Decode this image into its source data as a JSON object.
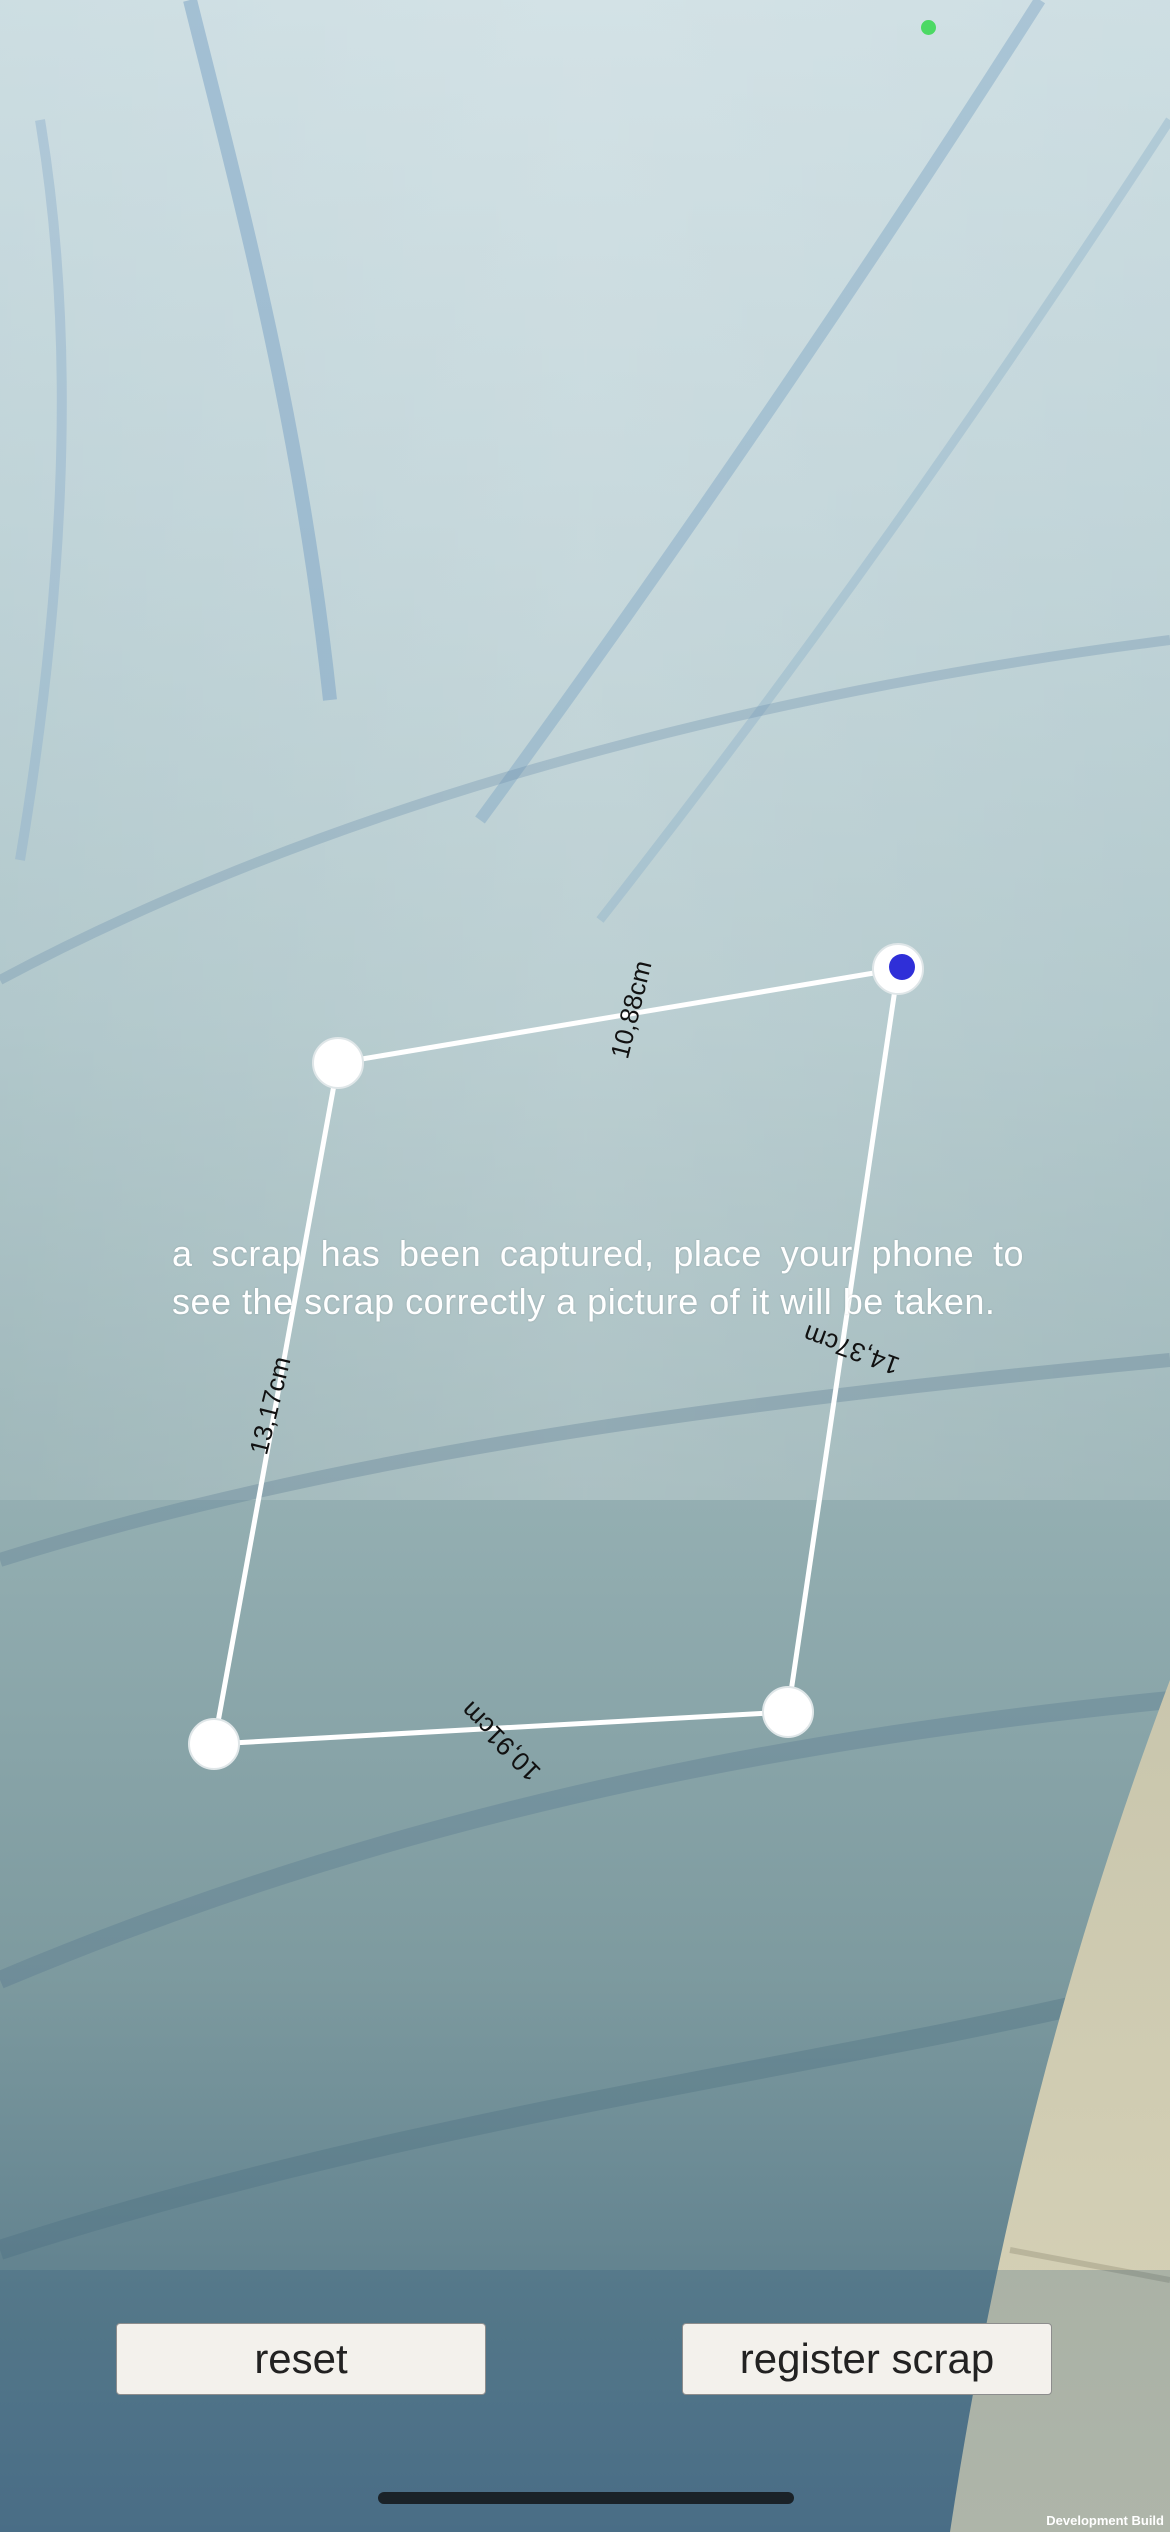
{
  "instruction": "a scrap has been captured, place your phone to see the scrap correctly a picture of it will be taken.",
  "measurements": {
    "top": "10,88cm",
    "right": "14,37cm",
    "bottom": "10,91cm",
    "left": "13,17cm"
  },
  "buttons": {
    "reset": "reset",
    "register": "register scrap"
  },
  "footer": {
    "dev_build": "Development Build"
  },
  "colors": {
    "status_dot": "#4cd964",
    "selected_handle": "#2f2fd8",
    "handle": "#ffffff",
    "edge": "#ffffff"
  },
  "icons": {
    "status_indicator": "green-dot",
    "selected_corner": "blue-dot-handle"
  }
}
